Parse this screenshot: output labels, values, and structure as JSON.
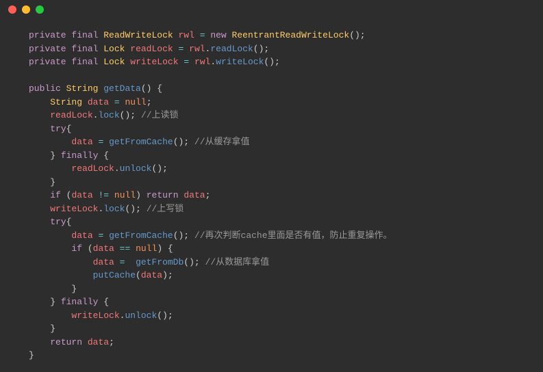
{
  "titlebar": {
    "close": "close",
    "minimize": "minimize",
    "maximize": "maximize"
  },
  "code": {
    "l1": {
      "kw1": "private",
      "kw2": "final",
      "type": "ReadWriteLock",
      "ident": "rwl",
      "op": "=",
      "kw3": "new",
      "ctor": "ReentrantReadWriteLock",
      "p1": "();"
    },
    "l2": {
      "kw1": "private",
      "kw2": "final",
      "type": "Lock",
      "ident": "readLock",
      "op": "=",
      "obj": "rwl",
      "dot": ".",
      "method": "readLock",
      "p1": "();"
    },
    "l3": {
      "kw1": "private",
      "kw2": "final",
      "type": "Lock",
      "ident": "writeLock",
      "op": "=",
      "obj": "rwl",
      "dot": ".",
      "method": "writeLock",
      "p1": "();"
    },
    "l5": {
      "kw1": "public",
      "type": "String",
      "method": "getData",
      "p1": "() {"
    },
    "l6": {
      "type": "String",
      "ident": "data",
      "op": "=",
      "null": "null",
      "p1": ";"
    },
    "l7": {
      "obj": "readLock",
      "dot": ".",
      "method": "lock",
      "p1": "(); ",
      "comment": "//上读锁"
    },
    "l8": {
      "kw1": "try",
      "p1": "{"
    },
    "l9": {
      "ident": "data",
      "op": "=",
      "method": "getFromCache",
      "p1": "(); ",
      "comment": "//从缓存拿值"
    },
    "l10": {
      "p1": "} ",
      "kw1": "finally",
      "p2": " {"
    },
    "l11": {
      "obj": "readLock",
      "dot": ".",
      "method": "unlock",
      "p1": "();"
    },
    "l12": {
      "p1": "}"
    },
    "l13": {
      "kw1": "if",
      "p1": " (",
      "ident": "data",
      "op": "!=",
      "null": "null",
      "p2": ") ",
      "kw2": "return",
      "ident2": "data",
      "p3": ";"
    },
    "l14": {
      "obj": "writeLock",
      "dot": ".",
      "method": "lock",
      "p1": "(); ",
      "comment": "//上写锁"
    },
    "l15": {
      "kw1": "try",
      "p1": "{"
    },
    "l16": {
      "ident": "data",
      "op": "=",
      "method": "getFromCache",
      "p1": "(); ",
      "comment": "//再次判断cache里面是否有值，防止重复操作。"
    },
    "l17": {
      "kw1": "if",
      "p1": " (",
      "ident": "data",
      "op": "==",
      "null": "null",
      "p2": ") {"
    },
    "l18": {
      "ident": "data",
      "op": "=",
      "method": "getFromDb",
      "p1": "(); ",
      "comment": "//从数据库拿值"
    },
    "l19": {
      "method": "putCache",
      "p1": "(",
      "ident": "data",
      "p2": ");"
    },
    "l20": {
      "p1": "}"
    },
    "l21": {
      "p1": "} ",
      "kw1": "finally",
      "p2": " {"
    },
    "l22": {
      "obj": "writeLock",
      "dot": ".",
      "method": "unlock",
      "p1": "();"
    },
    "l23": {
      "p1": "}"
    },
    "l24": {
      "kw1": "return",
      "ident": "data",
      "p1": ";"
    },
    "l25": {
      "p1": "}"
    }
  }
}
